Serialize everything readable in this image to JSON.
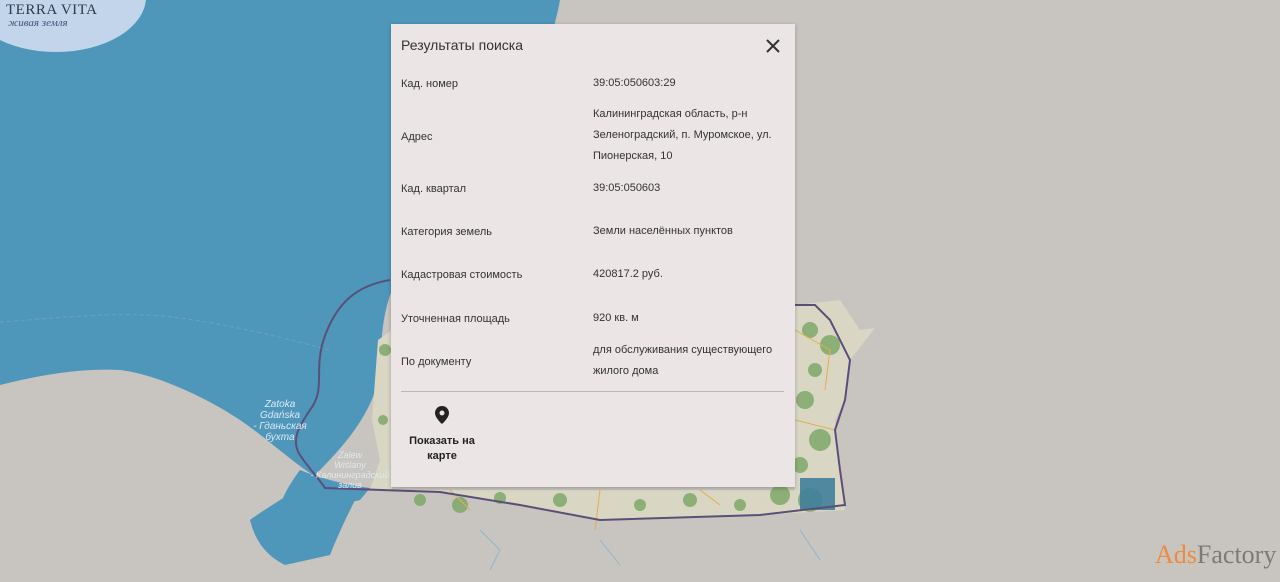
{
  "logo": {
    "name": "TERRA VITA",
    "tagline": "живая земля"
  },
  "map": {
    "labels": {
      "zatoka": "Zatoka\nGdańska\n- Гданьская\nбухта",
      "zalew": "Zalew\nWiślany\n- Калининградский\nзалив"
    }
  },
  "panel": {
    "title": "Результаты поиска",
    "rows": [
      {
        "key": "Кад. номер",
        "value": "39:05:050603:29"
      },
      {
        "key": "Адрес",
        "value": "Калининградская область, р-н Зеленоградский, п. Муромское, ул. Пионерская, 10"
      },
      {
        "key": "Кад. квартал",
        "value": "39:05:050603"
      },
      {
        "key": "Категория земель",
        "value": "Земли населённых пунктов"
      },
      {
        "key": "Кадастровая стоимость",
        "value": "420817.2 руб."
      },
      {
        "key": "Уточненная площадь",
        "value": "920 кв. м"
      },
      {
        "key": "По документу",
        "value": "для обслуживания существующего жилого дома"
      }
    ],
    "show_on_map": "Показать на карте"
  },
  "watermark": {
    "ads": "Ads",
    "factory": "Factory"
  },
  "colors": {
    "sea": "#4e97bb",
    "land": "#c8c4bf",
    "panel": "#ebe6e5",
    "border": "#5b4f78"
  }
}
